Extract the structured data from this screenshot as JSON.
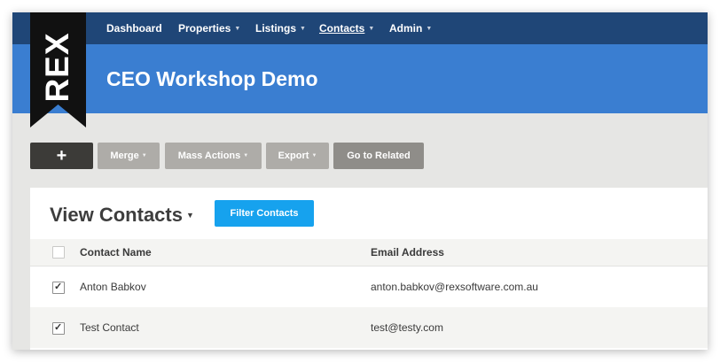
{
  "nav": {
    "items": [
      {
        "label": "Dashboard",
        "has_dropdown": false,
        "active": false
      },
      {
        "label": "Properties",
        "has_dropdown": true,
        "active": false
      },
      {
        "label": "Listings",
        "has_dropdown": true,
        "active": false
      },
      {
        "label": "Contacts",
        "has_dropdown": true,
        "active": true
      },
      {
        "label": "Admin",
        "has_dropdown": true,
        "active": false
      }
    ]
  },
  "logo": {
    "text": "REX"
  },
  "header": {
    "title": "CEO Workshop Demo"
  },
  "toolbar": {
    "add_icon": "plus-icon",
    "merge_label": "Merge",
    "mass_actions_label": "Mass Actions",
    "export_label": "Export",
    "goto_related_label": "Go to Related"
  },
  "view": {
    "title": "View Contacts",
    "filter_label": "Filter Contacts"
  },
  "table": {
    "columns": [
      "Contact Name",
      "Email Address"
    ],
    "rows": [
      {
        "name": "Anton Babkov",
        "email": "anton.babkov@rexsoftware.com.au",
        "checked": true
      },
      {
        "name": "Test Contact",
        "email": "test@testy.com",
        "checked": true
      }
    ]
  },
  "colors": {
    "nav_bg": "#1f4677",
    "header_bg": "#3a7ed1",
    "toolbar_button": "#aeaca8",
    "add_button": "#3c3b38",
    "filter_button": "#16a2ee",
    "logo_bg": "#111111"
  }
}
